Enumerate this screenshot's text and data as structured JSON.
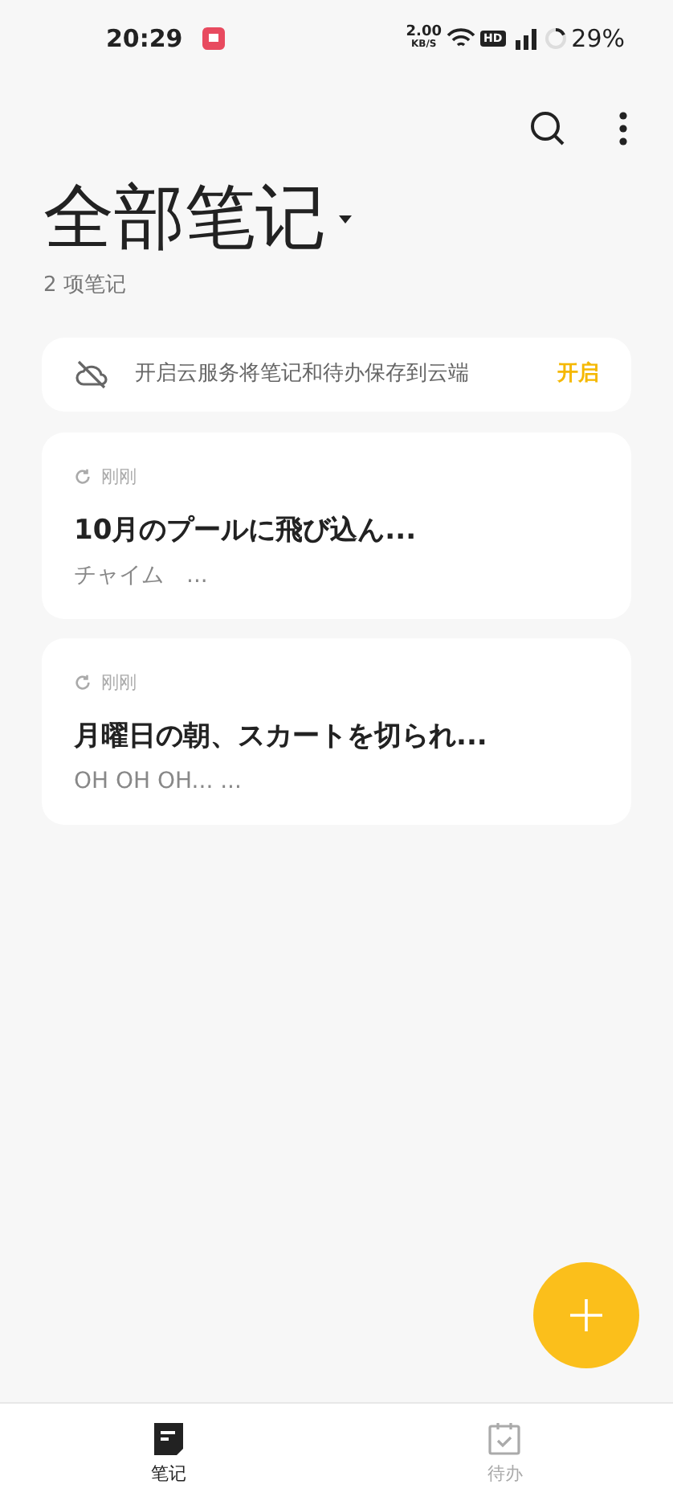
{
  "status_bar": {
    "time": "20:29",
    "speed": "2.00",
    "speed_unit": "KB/S",
    "network": "HD",
    "battery": "29%"
  },
  "title": "全部笔记",
  "count": "2 项笔记",
  "cloud_banner": {
    "text": "开启云服务将笔记和待办保存到云端",
    "action": "开启"
  },
  "notes": [
    {
      "time": "刚刚",
      "title": "10月のプールに飛び込ん...",
      "preview": "チャイム　..."
    },
    {
      "time": "刚刚",
      "title": "月曜日の朝、スカートを切られ...",
      "preview": "OH OH OH... ..."
    }
  ],
  "tabs": [
    {
      "label": "笔记",
      "kind": "notes",
      "selected": true
    },
    {
      "label": "待办",
      "kind": "todo",
      "selected": false
    }
  ]
}
